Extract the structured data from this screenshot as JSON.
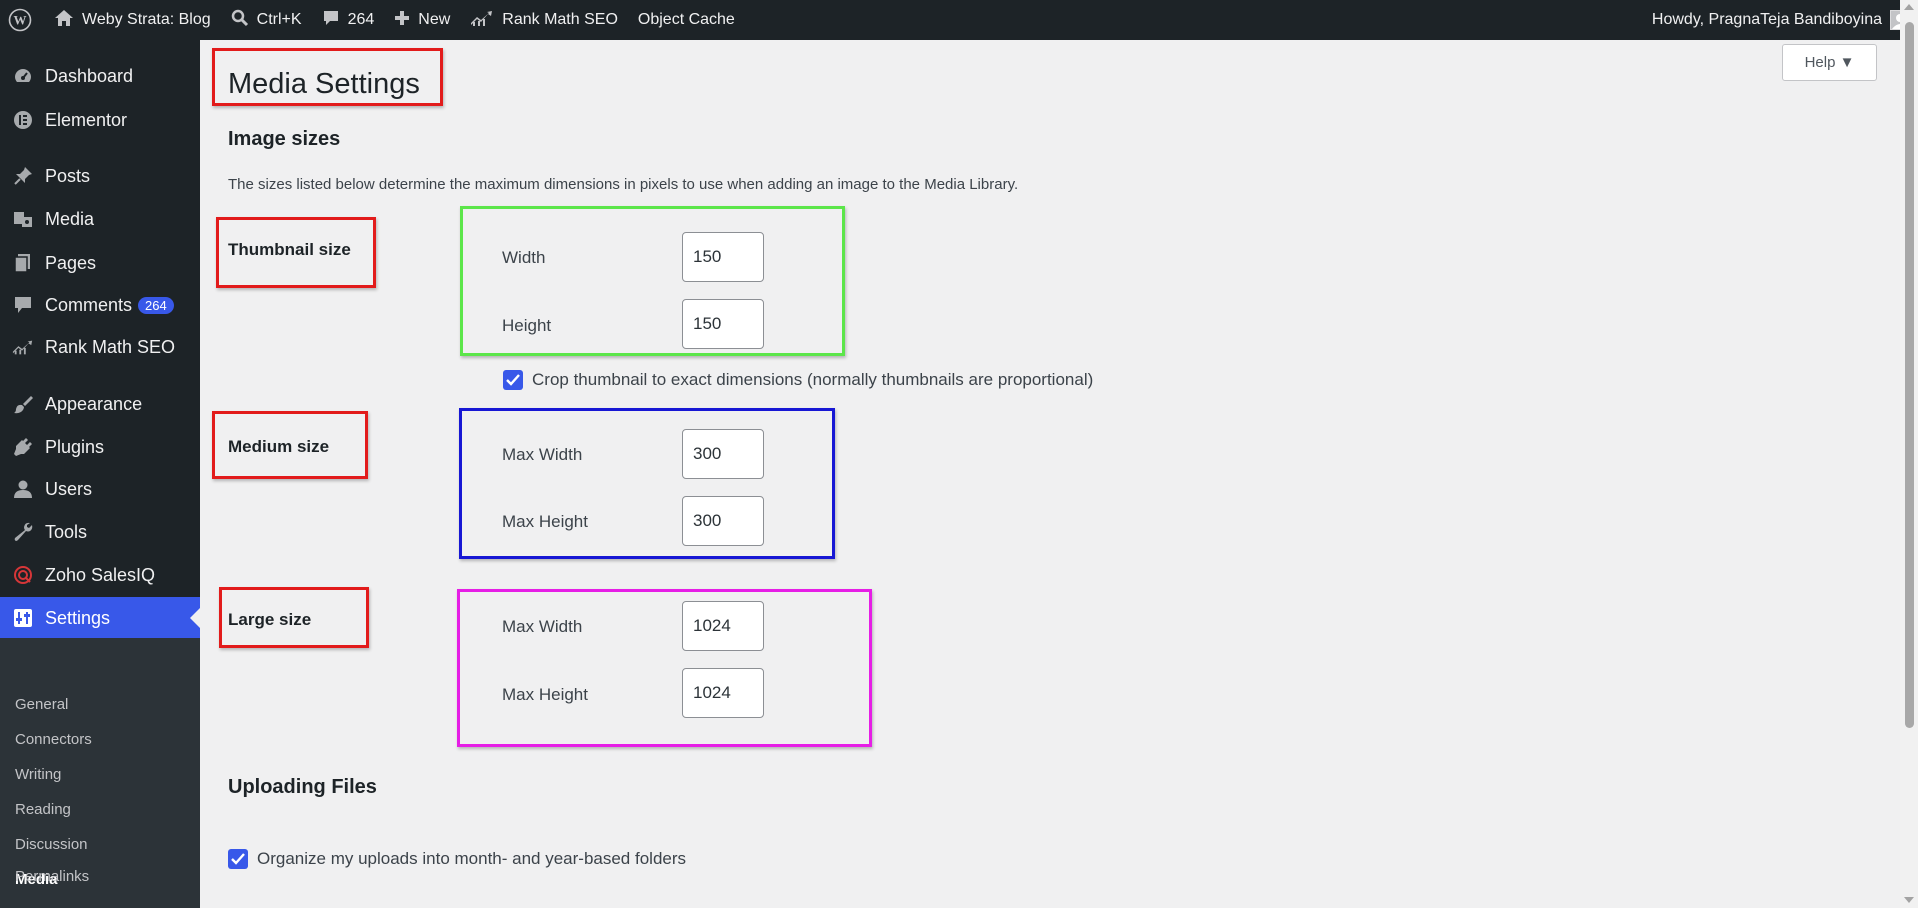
{
  "adminbar": {
    "site_name": "Weby Strata: Blog",
    "search_shortcut": "Ctrl+K",
    "comments_count": "264",
    "new_label": "New",
    "rankmath_label": "Rank Math SEO",
    "object_cache_label": "Object Cache",
    "howdy": "Howdy, PragnaTeja Bandiboyina"
  },
  "sidebar": {
    "items": [
      {
        "label": "Dashboard",
        "icon": "dashboard-icon"
      },
      {
        "label": "Elementor",
        "icon": "elementor-icon"
      },
      {
        "label": "Posts",
        "icon": "pin-icon"
      },
      {
        "label": "Media",
        "icon": "media-icon"
      },
      {
        "label": "Pages",
        "icon": "pages-icon"
      },
      {
        "label": "Comments",
        "icon": "comment-icon",
        "badge": "264"
      },
      {
        "label": "Rank Math SEO",
        "icon": "rankmath-icon"
      },
      {
        "label": "Appearance",
        "icon": "brush-icon"
      },
      {
        "label": "Plugins",
        "icon": "plug-icon"
      },
      {
        "label": "Users",
        "icon": "user-icon"
      },
      {
        "label": "Tools",
        "icon": "wrench-icon"
      },
      {
        "label": "Zoho SalesIQ",
        "icon": "zoho-icon"
      },
      {
        "label": "Settings",
        "icon": "settings-icon"
      }
    ],
    "submenu": [
      "General",
      "Connectors",
      "Writing",
      "Reading",
      "Discussion",
      "Media",
      "Permalinks"
    ]
  },
  "main": {
    "help_label": "Help ▼",
    "title": "Media Settings",
    "image_sizes_heading": "Image sizes",
    "description": "The sizes listed below determine the maximum dimensions in pixels to use when adding an image to the Media Library.",
    "thumbnail": {
      "label": "Thumbnail size",
      "width_label": "Width",
      "width": "150",
      "height_label": "Height",
      "height": "150",
      "crop_label": "Crop thumbnail to exact dimensions (normally thumbnails are proportional)"
    },
    "medium": {
      "label": "Medium size",
      "width_label": "Max Width",
      "width": "300",
      "height_label": "Max Height",
      "height": "300"
    },
    "large": {
      "label": "Large size",
      "width_label": "Max Width",
      "width": "1024",
      "height_label": "Max Height",
      "height": "1024"
    },
    "uploading_heading": "Uploading Files",
    "organize_label": "Organize my uploads into month- and year-based folders"
  },
  "colors": {
    "accent": "#3858e9",
    "annotation_red": "#e21b1b",
    "annotation_green": "#5ce64a",
    "annotation_blue": "#1717d4",
    "annotation_magenta": "#e61ee6"
  }
}
